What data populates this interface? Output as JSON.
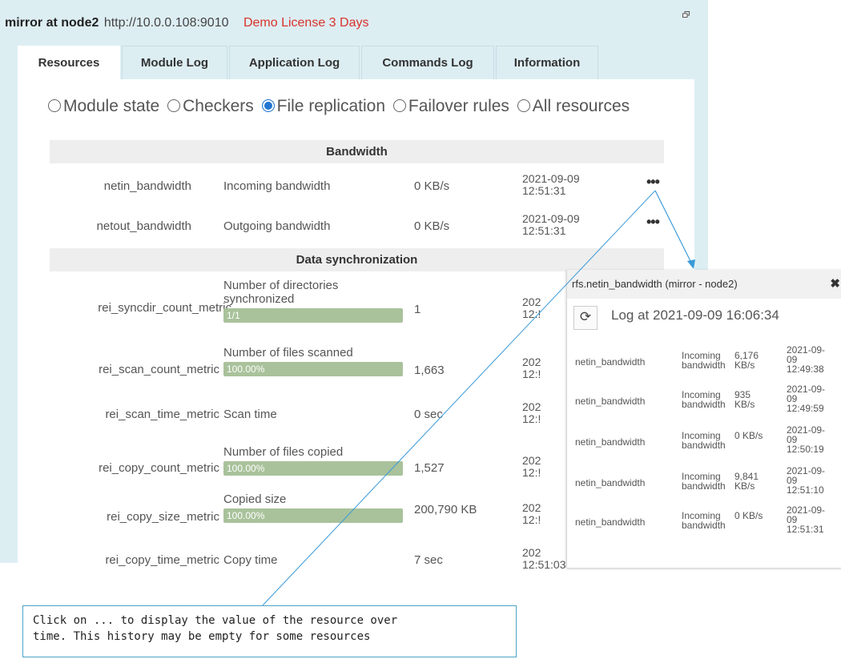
{
  "window": {
    "node": "mirror at node2",
    "url": "http://10.0.0.108:9010",
    "license": "Demo License 3 Days"
  },
  "tabs": [
    {
      "label": "Resources",
      "active": true
    },
    {
      "label": "Module Log"
    },
    {
      "label": "Application Log"
    },
    {
      "label": "Commands Log"
    },
    {
      "label": "Information"
    }
  ],
  "filter": {
    "options": [
      {
        "label": "Module state",
        "checked": false
      },
      {
        "label": "Checkers",
        "checked": false
      },
      {
        "label": "File replication",
        "checked": true
      },
      {
        "label": "Failover rules",
        "checked": false
      },
      {
        "label": "All resources",
        "checked": false
      }
    ]
  },
  "sections": {
    "bandwidth": "Bandwidth",
    "sync": "Data synchronization"
  },
  "bandwidth_rows": [
    {
      "name": "netin_bandwidth",
      "desc": "Incoming bandwidth",
      "value": "0 KB/s",
      "date": "2021-09-09 12:51:31",
      "more": "•••"
    },
    {
      "name": "netout_bandwidth",
      "desc": "Outgoing bandwidth",
      "value": "0 KB/s",
      "date": "2021-09-09 12:51:31",
      "more": "•••"
    }
  ],
  "sync_rows": [
    {
      "name": "rei_syncdir_count_metric",
      "desc": "Number of directories synchronized",
      "bar": "1/1",
      "progress": 1.0,
      "value": "1",
      "date": "202 12:!"
    },
    {
      "name": "rei_scan_count_metric",
      "desc": "Number of files scanned",
      "bar": "100.00%",
      "progress": 1.0,
      "value": "1,663",
      "date": "202 12:!"
    },
    {
      "name": "rei_scan_time_metric",
      "desc": "Scan time",
      "value": "0 sec",
      "date": "202 12:!"
    },
    {
      "name": "rei_copy_count_metric",
      "desc": "Number of files copied",
      "bar": "100.00%",
      "progress": 1.0,
      "value": "1,527",
      "date": "202 12:!"
    },
    {
      "name": "rei_copy_size_metric",
      "desc": "Copied size",
      "bar": "100.00%",
      "progress": 1.0,
      "value": "200,790 KB",
      "date": "202 12:!"
    },
    {
      "name": "rei_copy_time_metric",
      "desc": "Copy time",
      "value": "7 sec",
      "date": "202 12:51:03"
    }
  ],
  "popup": {
    "title": "rfs.netin_bandwidth (mirror - node2)",
    "close": "✖",
    "log_at": "Log at 2021-09-09 16:06:34",
    "rows": [
      {
        "name": "netin_bandwidth",
        "desc": "Incoming bandwidth",
        "value": "6,176 KB/s",
        "date": "2021-09-09 12:49:38"
      },
      {
        "name": "netin_bandwidth",
        "desc": "Incoming bandwidth",
        "value": "935 KB/s",
        "date": "2021-09-09 12:49:59"
      },
      {
        "name": "netin_bandwidth",
        "desc": "Incoming bandwidth",
        "value": "0 KB/s",
        "date": "2021-09-09 12:50:19"
      },
      {
        "name": "netin_bandwidth",
        "desc": "Incoming bandwidth",
        "value": "9,841 KB/s",
        "date": "2021-09-09 12:51:10"
      },
      {
        "name": "netin_bandwidth",
        "desc": "Incoming bandwidth",
        "value": "0 KB/s",
        "date": "2021-09-09 12:51:31"
      }
    ]
  },
  "callout": {
    "line1": "Click on ... to display the value of the resource over",
    "line2": "time. This history may be empty for some resources"
  },
  "colors": {
    "window_bg": "#ddeef3",
    "license": "#d9342b",
    "progress": "#a9c29b",
    "radio_checked": "#2176d2",
    "arrow": "#3a9ad9"
  }
}
